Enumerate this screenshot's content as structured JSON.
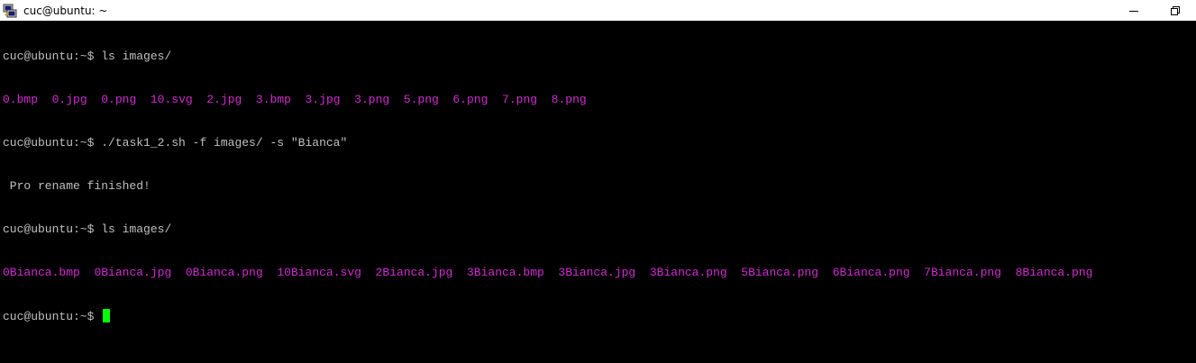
{
  "window": {
    "title": "cuc@ubuntu: ~"
  },
  "terminal": {
    "prompt": "cuc@ubuntu:~$",
    "commands": {
      "ls1": "ls images/",
      "rename": "./task1_2.sh -f images/ -s \"Bianca\"",
      "ls2": "ls images/"
    },
    "output": {
      "files_before": [
        "0.bmp",
        "0.jpg",
        "0.png",
        "10.svg",
        "2.jpg",
        "3.bmp",
        "3.jpg",
        "3.png",
        "5.png",
        "6.png",
        "7.png",
        "8.png"
      ],
      "rename_message": " Pro rename finished!",
      "files_after": [
        "0Bianca.bmp",
        "0Bianca.jpg",
        "0Bianca.png",
        "10Bianca.svg",
        "2Bianca.jpg",
        "3Bianca.bmp",
        "3Bianca.jpg",
        "3Bianca.png",
        "5Bianca.png",
        "6Bianca.png",
        "7Bianca.png",
        "8Bianca.png"
      ]
    },
    "colors": {
      "background": "#000000",
      "text": "#c0c0c0",
      "file_listing": "#d12cd1",
      "cursor": "#00ff00"
    }
  }
}
